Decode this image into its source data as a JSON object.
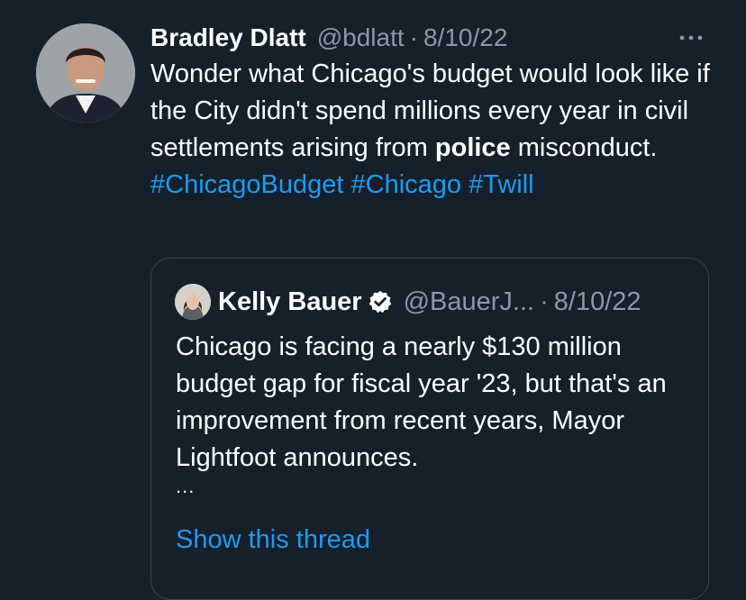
{
  "tweet": {
    "author_name": "Bradley Dlatt",
    "handle": "@bdlatt",
    "separator": "·",
    "date": "8/10/22",
    "more_icon": "more-horizontal-icon",
    "text_part1": "Wonder what Chicago's budget would look like if the City didn't spend millions every year in civil settlements arising from ",
    "text_bold": "police",
    "text_part2": " misconduct. ",
    "hashtags": [
      "#ChicagoBudget",
      "#Chicago",
      "#Twill"
    ]
  },
  "quoted_tweet": {
    "author_name": "Kelly Bauer",
    "verified_icon": "verified-badge-icon",
    "handle": "@BauerJ...",
    "separator": "·",
    "date": "8/10/22",
    "text": "Chicago is facing a nearly $130 million budget gap for fiscal year '23, but that's an improvement from recent years, Mayor Lightfoot announces.",
    "ellipsis": "...",
    "show_thread": "Show this thread"
  },
  "colors": {
    "background": "#15202b",
    "text": "#ffffff",
    "secondary_text": "#8b98a5",
    "link": "#1d9bf0",
    "border": "#38444d"
  }
}
